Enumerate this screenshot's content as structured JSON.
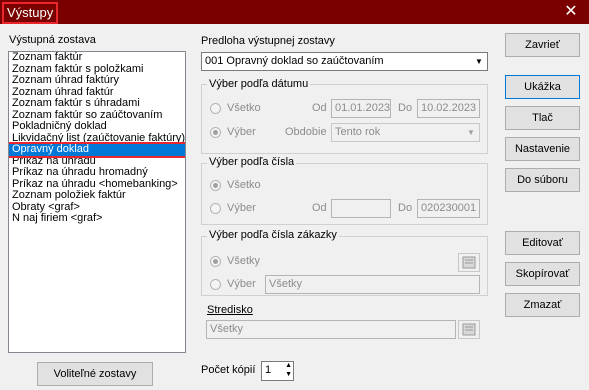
{
  "window": {
    "title": "Výstupy",
    "close_symbol": "✕"
  },
  "left": {
    "label": "Výstupná zostava",
    "items": [
      "Zoznam faktúr",
      "Zoznam faktúr s položkami",
      "Zoznam úhrad faktúry",
      "Zoznam úhrad faktúr",
      "Zoznam faktúr s úhradami",
      "Zoznam faktúr so zaúčtovaním",
      "Pokladničný doklad",
      "Likvidačný list (zaúčtovanie faktúry)",
      "Opravný doklad",
      "Príkaz na úhradu",
      "Príkaz na úhradu hromadný",
      "Príkaz na úhradu <homebanking>",
      "Zoznam položiek faktúr",
      "Obraty <graf>",
      "N naj firiem  <graf>"
    ],
    "selected_index": 8,
    "optional_button": "Voliteľné zostavy"
  },
  "template": {
    "label": "Predloha výstupnej zostavy",
    "value": "001 Opravný doklad so zaúčtovaním"
  },
  "date_group": {
    "title": "Výber podľa dátumu",
    "all_label": "Všetko",
    "select_label": "Výber",
    "from_label": "Od",
    "from_value": "01.01.2023",
    "to_label": "Do",
    "to_value": "10.02.2023",
    "period_label": "Obdobie",
    "period_value": "Tento rok"
  },
  "number_group": {
    "title": "Výber podľa čísla",
    "all_label": "Všetko",
    "select_label": "Výber",
    "from_label": "Od",
    "from_value": "",
    "to_label": "Do",
    "to_value": "020230001"
  },
  "order_group": {
    "title": "Výber podľa čísla zákazky",
    "all_label": "Všetky",
    "select_label": "Výber",
    "value": "Všetky"
  },
  "center": {
    "title": "Stredisko",
    "value": "Všetky"
  },
  "copies": {
    "label": "Počet kópií",
    "value": "1"
  },
  "buttons": {
    "close": "Zavrieť",
    "preview": "Ukážka",
    "print": "Tlač",
    "settings": "Nastavenie",
    "to_file": "Do súboru",
    "edit": "Editovať",
    "copy": "Skopírovať",
    "delete": "Zmazať"
  }
}
